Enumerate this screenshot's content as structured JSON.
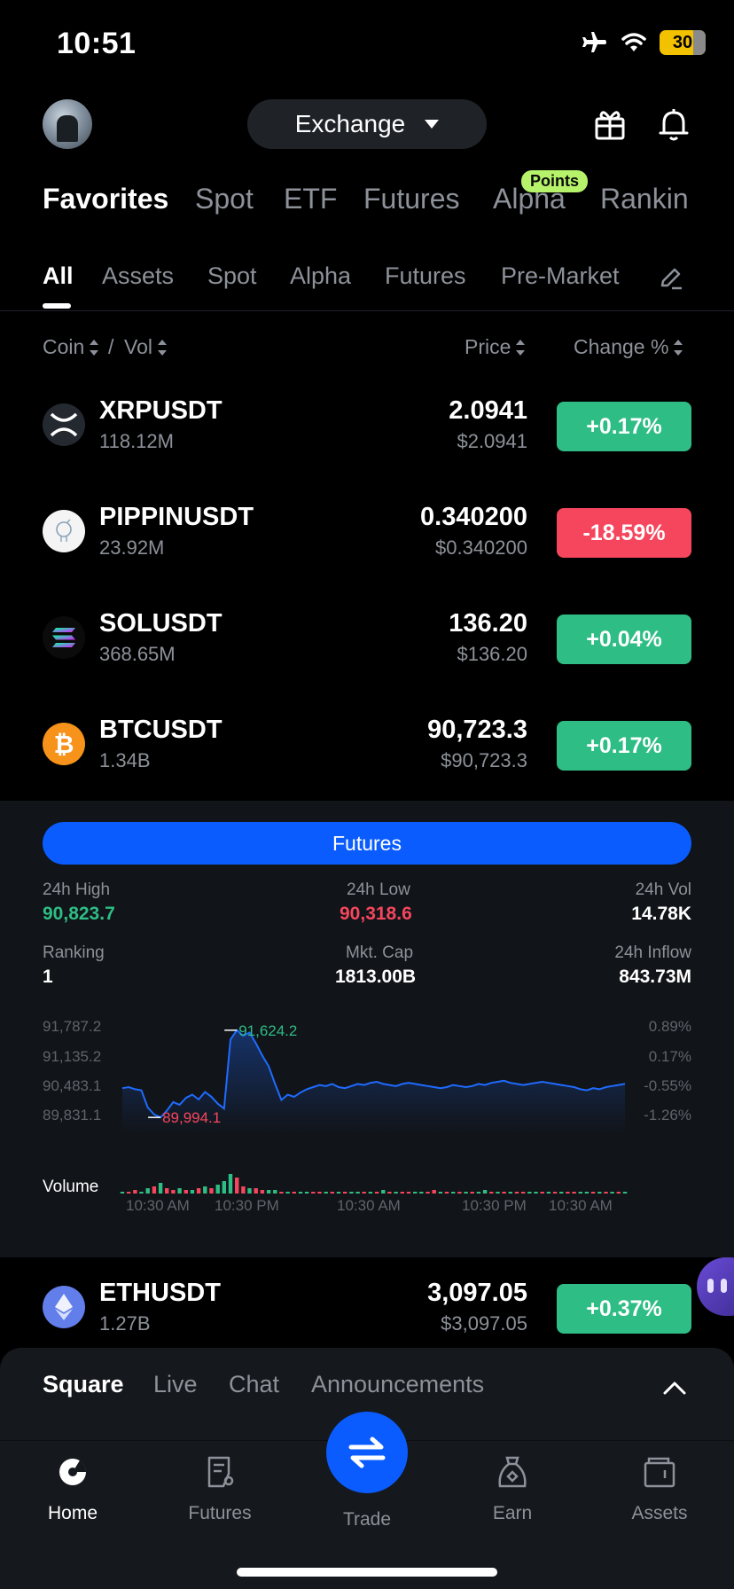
{
  "status_bar": {
    "time": "10:51",
    "battery": "30"
  },
  "header": {
    "exchange_label": "Exchange"
  },
  "main_tabs": [
    {
      "label": "Favorites"
    },
    {
      "label": "Spot"
    },
    {
      "label": "ETF"
    },
    {
      "label": "Futures"
    },
    {
      "label": "Alpha",
      "badge": "Points"
    },
    {
      "label": "Rankin"
    }
  ],
  "sub_tabs": [
    {
      "label": "All"
    },
    {
      "label": "Assets"
    },
    {
      "label": "Spot"
    },
    {
      "label": "Alpha"
    },
    {
      "label": "Futures"
    },
    {
      "label": "Pre-Market"
    }
  ],
  "columns": {
    "coin": "Coin",
    "slash": "/",
    "vol": "Vol",
    "price": "Price",
    "change": "Change %"
  },
  "rows": [
    {
      "pair": "XRPUSDT",
      "vol": "118.12M",
      "price": "2.0941",
      "price_usd": "$2.0941",
      "change": "+0.17%",
      "direction": "up"
    },
    {
      "pair": "PIPPINUSDT",
      "vol": "23.92M",
      "price": "0.340200",
      "price_usd": "$0.340200",
      "change": "-18.59%",
      "direction": "down"
    },
    {
      "pair": "SOLUSDT",
      "vol": "368.65M",
      "price": "136.20",
      "price_usd": "$136.20",
      "change": "+0.04%",
      "direction": "up"
    },
    {
      "pair": "BTCUSDT",
      "vol": "1.34B",
      "price": "90,723.3",
      "price_usd": "$90,723.3",
      "change": "+0.17%",
      "direction": "up"
    },
    {
      "pair": "ETHUSDT",
      "vol": "1.27B",
      "price": "3,097.05",
      "price_usd": "$3,097.05",
      "change": "+0.37%",
      "direction": "up"
    }
  ],
  "panel": {
    "button": "Futures",
    "stats": {
      "high_label": "24h High",
      "high": "90,823.7",
      "low_label": "24h Low",
      "low": "90,318.6",
      "vol_label": "24h Vol",
      "vol": "14.78K",
      "rank_label": "Ranking",
      "rank": "1",
      "cap_label": "Mkt. Cap",
      "cap": "1813.00B",
      "inflow_label": "24h Inflow",
      "inflow": "843.73M"
    },
    "y_left": [
      "91,787.2",
      "91,135.2",
      "90,483.1",
      "89,831.1"
    ],
    "y_right": [
      "0.89%",
      "0.17%",
      "-0.55%",
      "-1.26%"
    ],
    "max_label": "91,624.2",
    "min_label": "89,994.1",
    "volume_label": "Volume",
    "times": [
      "10:30 AM",
      "10:30 PM",
      "10:30 AM",
      "10:30 PM",
      "10:30 AM"
    ]
  },
  "chart_data": {
    "type": "line",
    "title": "",
    "ylim": [
      89831.1,
      91787.2
    ],
    "y": [
      90540,
      90560,
      90520,
      90500,
      90180,
      90050,
      89994.1,
      90120,
      90280,
      90230,
      90360,
      90420,
      90330,
      90470,
      90380,
      90250,
      90160,
      91450,
      91624.2,
      91520,
      91580,
      91380,
      91150,
      90950,
      90620,
      90320,
      90420,
      90380,
      90460,
      90520,
      90560,
      90600,
      90580,
      90620,
      90560,
      90540,
      90580,
      90620,
      90600,
      90640,
      90660,
      90620,
      90600,
      90580,
      90620,
      90640,
      90620,
      90600,
      90580,
      90560,
      90540,
      90560,
      90600,
      90580,
      90560,
      90580,
      90620,
      90600,
      90640,
      90660,
      90680,
      90640,
      90620,
      90600,
      90620,
      90640,
      90660,
      90640,
      90620,
      90600,
      90580,
      90560,
      90520,
      90500,
      90540,
      90520,
      90560,
      90580,
      90600,
      90620
    ],
    "volume": [
      1,
      1,
      2,
      1,
      3,
      4,
      6,
      3,
      2,
      3,
      2,
      2,
      3,
      4,
      3,
      5,
      7,
      11,
      9,
      4,
      3,
      3,
      2,
      2,
      2,
      1,
      1,
      1,
      1,
      1,
      1,
      1,
      1,
      1,
      1,
      1,
      1,
      1,
      1,
      1,
      1,
      2,
      1,
      1,
      1,
      1,
      1,
      1,
      1,
      2,
      1,
      1,
      1,
      1,
      1,
      1,
      1,
      2,
      1,
      1,
      1,
      1,
      1,
      1,
      1,
      1,
      1,
      1,
      1,
      1,
      1,
      1,
      1,
      1,
      1,
      1,
      1,
      1,
      1,
      1
    ],
    "volume_dir": [
      "u",
      "d",
      "d",
      "u",
      "u",
      "d",
      "u",
      "d",
      "d",
      "u",
      "d",
      "u",
      "d",
      "u",
      "d",
      "u",
      "u",
      "u",
      "d",
      "d",
      "u",
      "d",
      "d",
      "u",
      "u",
      "d",
      "u",
      "d",
      "u",
      "u",
      "d",
      "d",
      "u",
      "d",
      "u",
      "d",
      "u",
      "u",
      "d",
      "u",
      "d",
      "u",
      "d",
      "u",
      "d",
      "d",
      "u",
      "u",
      "d",
      "d",
      "u",
      "d",
      "u",
      "d",
      "u",
      "d",
      "u",
      "u",
      "d",
      "u",
      "d",
      "u",
      "d",
      "d",
      "u",
      "u",
      "d",
      "u",
      "d",
      "u",
      "d",
      "d",
      "u",
      "u",
      "d",
      "u",
      "d",
      "u",
      "d",
      "u"
    ]
  },
  "bottom_sheet": {
    "tabs": [
      {
        "label": "Square"
      },
      {
        "label": "Live"
      },
      {
        "label": "Chat"
      },
      {
        "label": "Announcements"
      }
    ]
  },
  "nav": [
    {
      "label": "Home"
    },
    {
      "label": "Futures"
    },
    {
      "label": "Trade"
    },
    {
      "label": "Earn"
    },
    {
      "label": "Assets"
    }
  ],
  "colors": {
    "up": "#2ebd85",
    "down": "#f6465d",
    "accent": "#0a5cff",
    "line": "#1f6bff"
  }
}
